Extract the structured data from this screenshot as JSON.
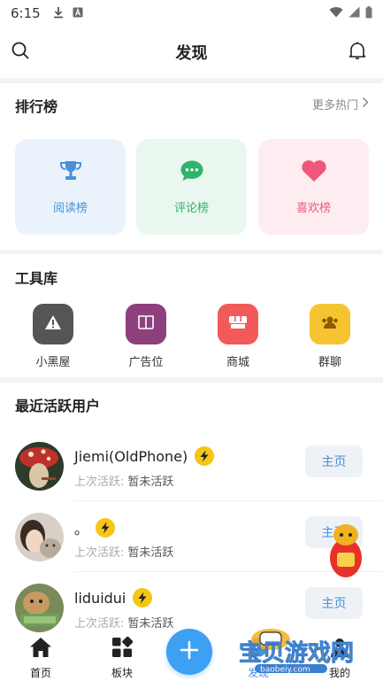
{
  "status_bar": {
    "time": "6:15"
  },
  "header": {
    "title": "发现"
  },
  "ranking": {
    "title": "排行榜",
    "more_label": "更多热门",
    "tiles": [
      {
        "label": "阅读榜",
        "icon": "trophy-icon",
        "color": "#4a90d9"
      },
      {
        "label": "评论榜",
        "icon": "chat-bubble-icon",
        "color": "#2fb36b"
      },
      {
        "label": "喜欢榜",
        "icon": "heart-icon",
        "color": "#f0577a"
      }
    ]
  },
  "tools": {
    "title": "工具库",
    "items": [
      {
        "label": "小黑屋",
        "icon": "warning-icon",
        "color": "#555555"
      },
      {
        "label": "广告位",
        "icon": "book-icon",
        "color": "#8e3f7e"
      },
      {
        "label": "商城",
        "icon": "store-icon",
        "color": "#f25a5a"
      },
      {
        "label": "群聊",
        "icon": "group-icon",
        "color": "#f6c431"
      }
    ]
  },
  "active_users": {
    "title": "最近活跃用户",
    "last_active_label": "上次活跃:",
    "home_button_label": "主页",
    "users": [
      {
        "name": "Jiemi(OldPhone)",
        "last_active": "暂未活跃"
      },
      {
        "name": "。",
        "last_active": "暂未活跃"
      },
      {
        "name": "liduidui",
        "last_active": "暂未活跃"
      }
    ]
  },
  "tab_bar": {
    "tabs": [
      {
        "label": "首页",
        "icon": "home-icon"
      },
      {
        "label": "板块",
        "icon": "grid-icon"
      },
      {
        "label": "发现",
        "icon": "discover-icon",
        "active": true
      },
      {
        "label": "我的",
        "icon": "person-icon"
      }
    ],
    "center_button_icon": "plus-icon"
  },
  "watermark": {
    "text": "宝贝游戏网",
    "url_text": "baobeiy.com"
  },
  "colors": {
    "accent": "#4a90d9",
    "fab": "#3da0f2",
    "bolt": "#f5c518"
  }
}
